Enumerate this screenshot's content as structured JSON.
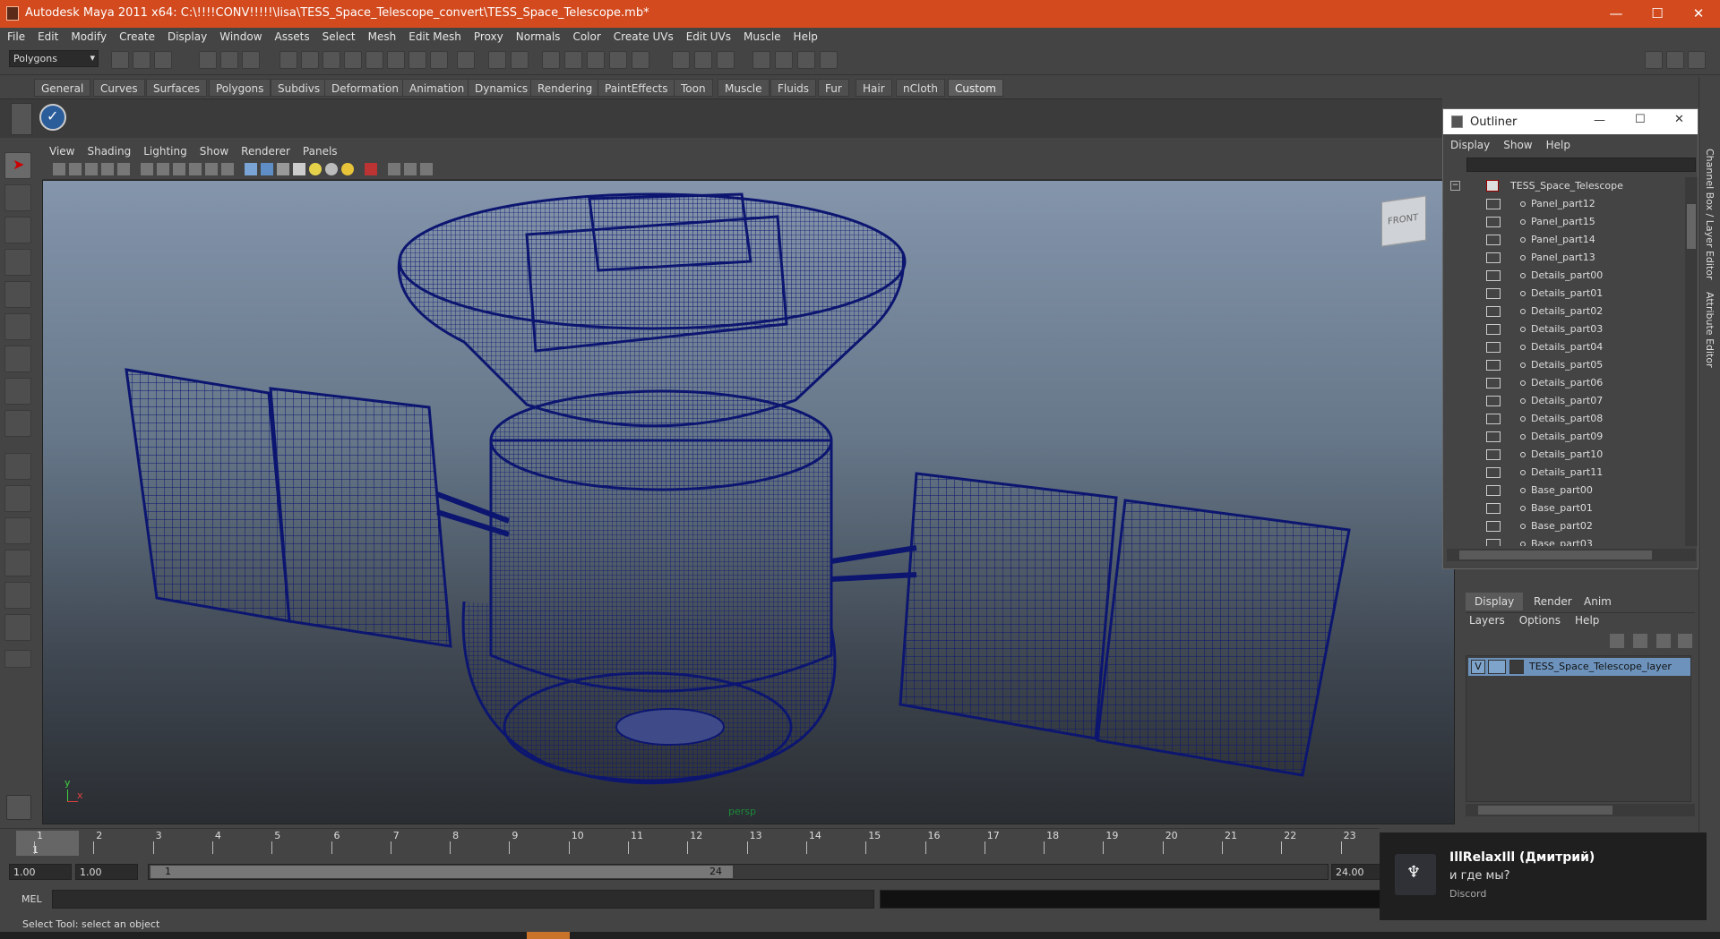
{
  "title_bar": {
    "title": "Autodesk Maya 2011 x64: C:\\!!!!CONV!!!!!\\lisa\\TESS_Space_Telescope_convert\\TESS_Space_Telescope.mb*",
    "minimize": "—",
    "maximize": "☐",
    "close": "✕"
  },
  "menu": [
    "File",
    "Edit",
    "Modify",
    "Create",
    "Display",
    "Window",
    "Assets",
    "Select",
    "Mesh",
    "Edit Mesh",
    "Proxy",
    "Normals",
    "Color",
    "Create UVs",
    "Edit UVs",
    "Muscle",
    "Help"
  ],
  "status_line": {
    "mode": "Polygons"
  },
  "shelf_tabs": [
    "General",
    "Curves",
    "Surfaces",
    "Polygons",
    "Subdivs",
    "Deformation",
    "Animation",
    "Dynamics",
    "Rendering",
    "PaintEffects",
    "Toon",
    "Muscle",
    "Fluids",
    "Fur",
    "Hair",
    "nCloth",
    "Custom"
  ],
  "shelf_active": "Custom",
  "viewport": {
    "menus": [
      "View",
      "Shading",
      "Lighting",
      "Show",
      "Renderer",
      "Panels"
    ],
    "camera_label": "persp",
    "viewcube": "FRONT",
    "axis_x": "x",
    "axis_y": "y",
    "wire_color": "#0c1670"
  },
  "outliner": {
    "title": "Outliner",
    "menus": [
      "Display",
      "Show",
      "Help"
    ],
    "root": "TESS_Space_Telescope",
    "items": [
      "Panel_part12",
      "Panel_part15",
      "Panel_part14",
      "Panel_part13",
      "Details_part00",
      "Details_part01",
      "Details_part02",
      "Details_part03",
      "Details_part04",
      "Details_part05",
      "Details_part06",
      "Details_part07",
      "Details_part08",
      "Details_part09",
      "Details_part10",
      "Details_part11",
      "Base_part00",
      "Base_part01",
      "Base_part02",
      "Base_part03"
    ]
  },
  "layers": {
    "tabs": [
      "Display",
      "Render",
      "Anim"
    ],
    "active_tab": "Display",
    "menus": [
      "Layers",
      "Options",
      "Help"
    ],
    "layer_visible": "V",
    "layer_name": "TESS_Space_Telescope_layer",
    "selected_color": "#6d93bd"
  },
  "right_strip": {
    "channel_box": "Channel Box / Layer Editor",
    "attribute_editor": "Attribute Editor"
  },
  "timeline": {
    "ticks": [
      "1",
      "2",
      "3",
      "4",
      "5",
      "6",
      "7",
      "8",
      "9",
      "10",
      "11",
      "12",
      "13",
      "14",
      "15",
      "16",
      "17",
      "18",
      "19",
      "20",
      "21",
      "22",
      "23"
    ],
    "current_frame": "1"
  },
  "range": {
    "start": "1.00",
    "inner_start": "1.00",
    "slider_start": "1",
    "slider_end": "24",
    "end": "24.00"
  },
  "command": {
    "label": "MEL"
  },
  "help_line": "Select Tool: select an object",
  "notification": {
    "user": "IllRelaxIll (Дмитрий)",
    "message": "и где мы?",
    "app": "Discord"
  },
  "colors": {
    "titlebar": "#d24a1e",
    "panel": "#444444"
  }
}
